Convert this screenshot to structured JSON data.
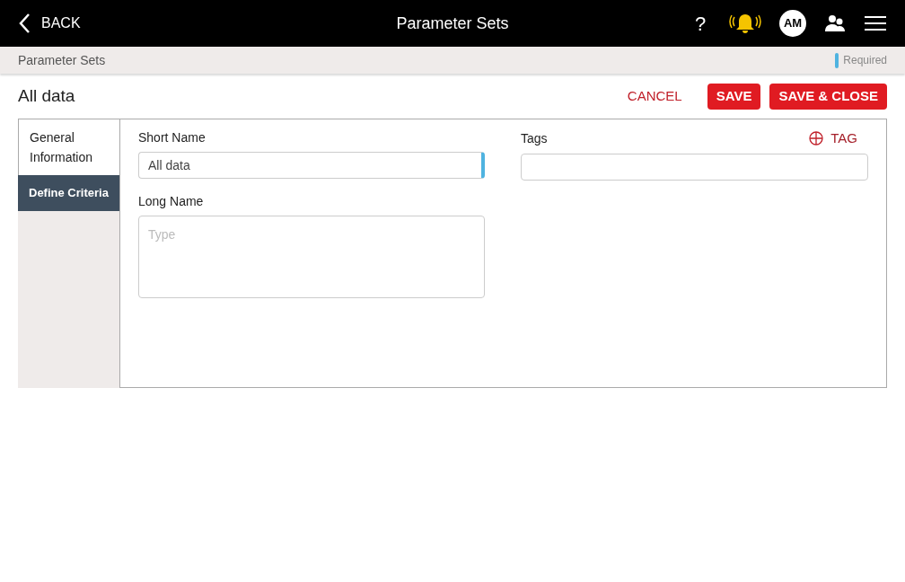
{
  "header": {
    "back": "BACK",
    "title": "Parameter Sets",
    "help": "?",
    "avatar": "AM"
  },
  "breadcrumb": {
    "path": "Parameter Sets",
    "legend": "Required"
  },
  "page": {
    "title": "All data",
    "cancel": "CANCEL",
    "save": "SAVE",
    "save_close": "SAVE & CLOSE"
  },
  "tabs": [
    {
      "label": "General Information",
      "selected": true
    },
    {
      "label": "Define Criteria",
      "selected": false
    }
  ],
  "short_name": {
    "label": "Short Name",
    "value": "All data",
    "required": true
  },
  "long_name": {
    "label": "Long Name",
    "placeholder": "Type",
    "required": false
  },
  "tags": {
    "label": "Tags",
    "add": "TAG",
    "required": false
  }
}
